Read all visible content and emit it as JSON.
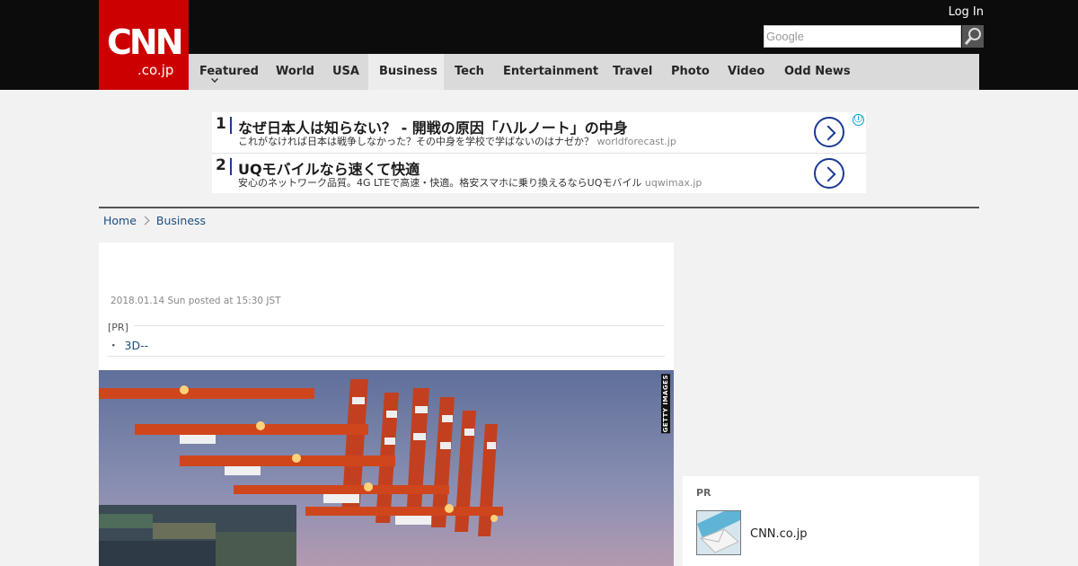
{
  "header": {
    "logo_main": "CNN",
    "logo_sub": ".co.jp",
    "login_label": "Log In",
    "search_placeholder": "Google"
  },
  "nav": {
    "items": [
      {
        "label": "Featured",
        "active": false,
        "has_dropdown": true
      },
      {
        "label": "World",
        "active": false
      },
      {
        "label": "USA",
        "active": false
      },
      {
        "label": "Business",
        "active": true
      },
      {
        "label": "Tech",
        "active": false
      },
      {
        "label": "Entertainment",
        "active": false
      },
      {
        "label": "Travel",
        "active": false
      },
      {
        "label": "Photo",
        "active": false
      },
      {
        "label": "Video",
        "active": false
      },
      {
        "label": "Odd News",
        "active": false
      }
    ]
  },
  "ads": {
    "items": [
      {
        "number": "1",
        "title": "なぜ日本人は知らない？ - 開戦の原因「ハルノート」の中身",
        "description": "これがなければ日本は戦争しなかった？その中身を学校で学ばないのはナゼか？",
        "domain": "worldforecast.jp"
      },
      {
        "number": "2",
        "title": "UQモバイルなら速くて快適",
        "description": "安心のネットワーク品質。4G LTEで高速・快適。格安スマホに乗り換えるならUQモバイル",
        "domain": "uqwimax.jp"
      }
    ],
    "info_icon": "ⓘ"
  },
  "breadcrumb": {
    "home": "Home",
    "section": "Business"
  },
  "article": {
    "dateline": "2018.01.14 Sun posted at 15:30 JST",
    "pr_label": "[PR]",
    "pr_bullet": "・",
    "pr_item": "3D--",
    "photo_credit": "GETTY IMAGES"
  },
  "sidebar": {
    "pr_label": "PR",
    "item_name": "CNN.co.jp"
  },
  "colors": {
    "brand_red": "#cc0000",
    "header_black": "#0c0c0c",
    "nav_gray": "#dadada",
    "link_blue": "#1c4e80",
    "ad_blue": "#1b3a93"
  }
}
